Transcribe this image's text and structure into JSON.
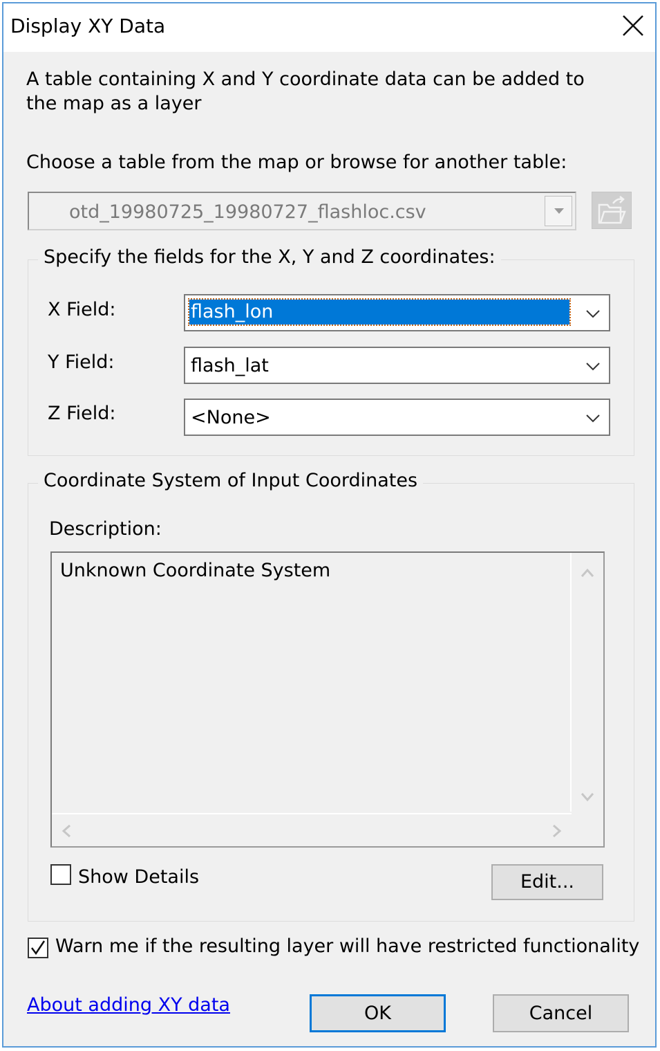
{
  "window": {
    "title": "Display XY Data",
    "close_icon": "close-icon"
  },
  "intro_text": "A table containing X and Y coordinate data can be added to the map as a layer",
  "table_section": {
    "label": "Choose a table from the map or browse for another table:",
    "selected_table": "otd_19980725_19980727_flashloc.csv",
    "browse_icon": "open-folder-icon"
  },
  "fields_group": {
    "legend": "Specify the fields for the X, Y and Z coordinates:",
    "x_label": "X Field:",
    "x_value": "flash_lon",
    "y_label": "Y Field:",
    "y_value": "flash_lat",
    "z_label": "Z Field:",
    "z_value": "<None>"
  },
  "coord_group": {
    "legend": "Coordinate System of Input Coordinates",
    "description_label": "Description:",
    "description_text": "Unknown Coordinate System",
    "show_details_label": "Show Details",
    "show_details_checked": false,
    "edit_label": "Edit..."
  },
  "warn_label": "Warn me if the resulting layer will have restricted functionality",
  "warn_checked": true,
  "help_link": "About adding XY data",
  "buttons": {
    "ok": "OK",
    "cancel": "Cancel"
  },
  "colors": {
    "selection": "#0078d7",
    "link": "#0000ee",
    "window_border": "#5a9bd8"
  }
}
